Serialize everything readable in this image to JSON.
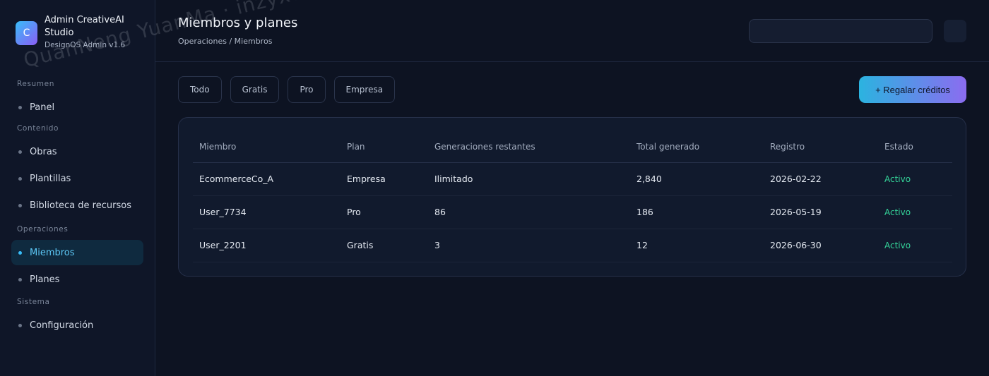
{
  "brand": {
    "logo_letter": "C",
    "name": "Admin CreativeAI Studio",
    "version": "DesignOS Admin v1.6"
  },
  "sidebar": {
    "sections": [
      {
        "label": "Resumen",
        "items": [
          {
            "label": "Panel",
            "active": false
          }
        ]
      },
      {
        "label": "Contenido",
        "items": [
          {
            "label": "Obras",
            "active": false
          },
          {
            "label": "Plantillas",
            "active": false
          },
          {
            "label": "Biblioteca de recursos",
            "active": false
          }
        ]
      },
      {
        "label": "Operaciones",
        "items": [
          {
            "label": "Miembros",
            "active": true
          },
          {
            "label": "Planes",
            "active": false
          }
        ]
      },
      {
        "label": "Sistema",
        "items": [
          {
            "label": "Configuración",
            "active": false
          }
        ]
      }
    ]
  },
  "header": {
    "title": "Miembros y planes",
    "breadcrumb": "Operaciones / Miembros",
    "search_value": ""
  },
  "filters": [
    "Todo",
    "Gratis",
    "Pro",
    "Empresa"
  ],
  "actions": {
    "gift_label": "+ Regalar créditos"
  },
  "table": {
    "columns": [
      "Miembro",
      "Plan",
      "Generaciones restantes",
      "Total generado",
      "Registro",
      "Estado"
    ],
    "rows": [
      [
        "EcommerceCo_A",
        "Empresa",
        "Ilimitado",
        "2,840",
        "2026-02-22",
        "Activo"
      ],
      [
        "User_7734",
        "Pro",
        "86",
        "186",
        "2026-05-19",
        "Activo"
      ],
      [
        "User_2201",
        "Gratis",
        "3",
        "12",
        "2026-06-30",
        "Activo"
      ]
    ]
  },
  "colors": {
    "accent": "#38bdf8",
    "status_active": "#34d399",
    "gradient_start": "#2bb3e0",
    "gradient_end": "#8b6cf0"
  },
  "watermark": "QuanNeng YuanMa · inzyxuashop.com"
}
